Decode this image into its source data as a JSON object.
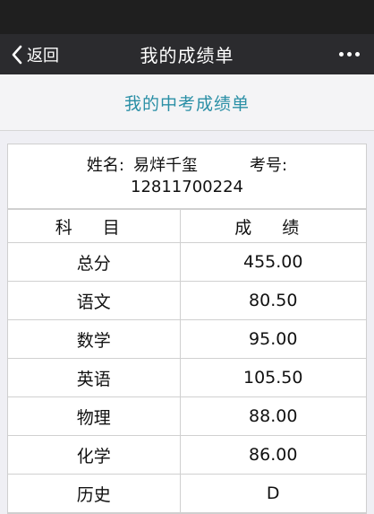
{
  "nav": {
    "back_label": "返回",
    "title": "我的成绩单"
  },
  "page": {
    "heading": "我的中考成绩单"
  },
  "student": {
    "name_label": "姓名:",
    "name": "易烊千玺",
    "exam_no_label": "考号:",
    "exam_no": "12811700224"
  },
  "table": {
    "headers": [
      "科 目",
      "成 绩"
    ],
    "rows": [
      {
        "subject": "总分",
        "score": "455.00"
      },
      {
        "subject": "语文",
        "score": "80.50"
      },
      {
        "subject": "数学",
        "score": "95.00"
      },
      {
        "subject": "英语",
        "score": "105.50"
      },
      {
        "subject": "物理",
        "score": "88.00"
      },
      {
        "subject": "化学",
        "score": "86.00"
      },
      {
        "subject": "历史",
        "score": "D"
      }
    ]
  },
  "colors": {
    "accent": "#2a8fa6",
    "navbar": "#2b2b2e"
  },
  "icons": {
    "back": "chevron-left-icon",
    "more": "more-icon"
  }
}
